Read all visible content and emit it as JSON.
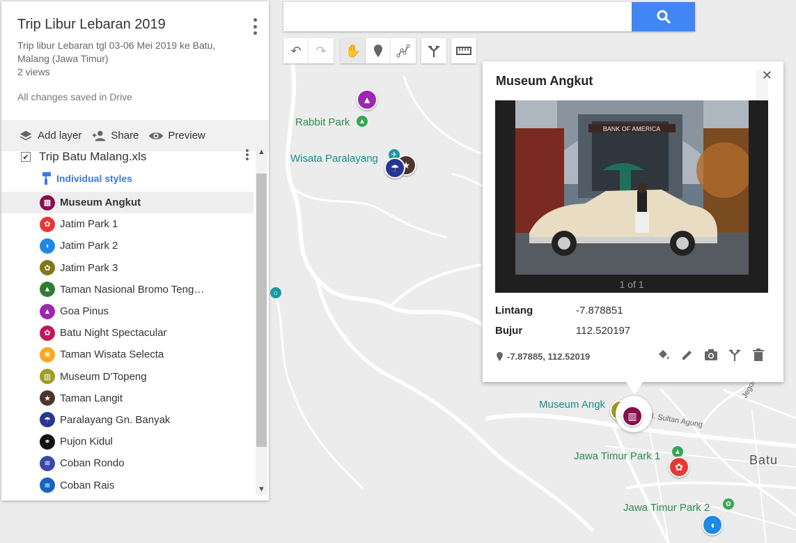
{
  "map_info": {
    "title": "Trip Libur Lebaran 2019",
    "description": "Trip libur Lebaran tgl 03-06 Mei 2019 ke Batu, Malang (Jawa Timur)",
    "views": "2 views",
    "saved_status": "All changes saved in Drive"
  },
  "actions": {
    "add_layer": "Add layer",
    "share": "Share",
    "preview": "Preview"
  },
  "layer": {
    "name": "Trip Batu Malang.xls",
    "styles_link": "Individual styles",
    "features": [
      {
        "label": "Museum Angkut",
        "color": "#880e4f",
        "icon": "museum-icon",
        "glyph": "▥"
      },
      {
        "label": "Jatim Park 1",
        "color": "#e53935",
        "icon": "amusement-icon",
        "glyph": "✿"
      },
      {
        "label": "Jatim Park 2",
        "color": "#1e88e5",
        "icon": "elephant-icon",
        "glyph": "◖"
      },
      {
        "label": "Jatim Park 3",
        "color": "#827717",
        "icon": "amusement-icon",
        "glyph": "✿"
      },
      {
        "label": "Taman Nasional Bromo Teng…",
        "color": "#2e7d32",
        "icon": "mountain-icon",
        "glyph": "▲"
      },
      {
        "label": "Goa Pinus",
        "color": "#9c27b0",
        "icon": "mountain-icon",
        "glyph": "▲"
      },
      {
        "label": "Batu Night Spectacular",
        "color": "#c2185b",
        "icon": "amusement-icon",
        "glyph": "✿"
      },
      {
        "label": "Taman Wisata Selecta",
        "color": "#f9a825",
        "icon": "flower-icon",
        "glyph": "❀"
      },
      {
        "label": "Museum D'Topeng",
        "color": "#9e9d24",
        "icon": "museum-icon",
        "glyph": "▥"
      },
      {
        "label": "Taman Langit",
        "color": "#4e342e",
        "icon": "star-icon",
        "glyph": "★"
      },
      {
        "label": "Paralayang Gn. Banyak",
        "color": "#283593",
        "icon": "paraglider-icon",
        "glyph": "☂"
      },
      {
        "label": "Pujon Kidul",
        "color": "#111111",
        "icon": "motorbike-icon",
        "glyph": "⚭"
      },
      {
        "label": "Coban Rondo",
        "color": "#3949ab",
        "icon": "waterfall-icon",
        "glyph": "≋"
      },
      {
        "label": "Coban Rais",
        "color": "#1565c0",
        "icon": "waterfall-icon",
        "glyph": "≋"
      }
    ]
  },
  "search": {
    "value": "",
    "placeholder": ""
  },
  "map_labels": {
    "rabbit_park": "Rabbit Park",
    "wisata_paralayang": "Wisata Paralayang",
    "museum_angkut": "Museum Angk",
    "jawa_timur_park_1": "Jawa Timur Park 1",
    "jawa_timur_park_2": "Jawa Timur Park 2",
    "batu": "Batu",
    "street_sultan_agung": "Jl. Sultan Agung",
    "street_negoro": "Jegoro"
  },
  "info_window": {
    "title": "Museum Angkut",
    "photo_count": "1 of 1",
    "lintang_label": "Lintang",
    "lintang_value": "-7.878851",
    "bujur_label": "Bujur",
    "bujur_value": "112.520197",
    "coords": "-7.87885, 112.52019",
    "photo_sign": "BANK OF AMERICA"
  },
  "colors": {
    "accent": "#4285f4",
    "link": "#3b78e7"
  }
}
